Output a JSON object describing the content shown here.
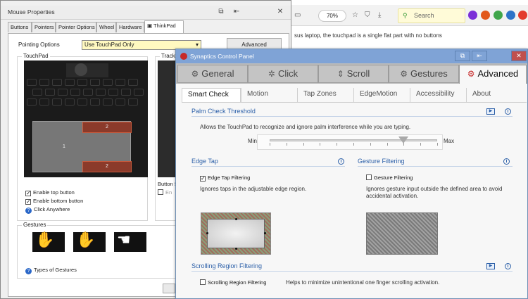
{
  "browser": {
    "zoom": "70%",
    "search_placeholder": "Search",
    "page_text": "sus laptop, the touchpad is a single flat part with no buttons"
  },
  "mouse_properties": {
    "title": "Mouse Properties",
    "tabs": [
      "Buttons",
      "Pointers",
      "Pointer Options",
      "Wheel",
      "Hardware",
      "ThinkPad"
    ],
    "pointing_options_label": "Pointing Options",
    "pointing_options_value": "Use TouchPad Only",
    "advanced_button": "Advanced",
    "touchpad_group": "TouchPad",
    "trackpoint_group": "TrackPo",
    "zone_top": "2",
    "zone_main": "1",
    "zone_bottom": "2",
    "enable_top_button": "Enable top button",
    "enable_bottom_button": "Enable bottom button",
    "click_anywhere": "Click Anywhere",
    "button_s_label": "Button S",
    "en_label": "En",
    "gestures_group": "Gestures",
    "types_of_gestures": "Types of Gestures"
  },
  "synaptics": {
    "title": "Synaptics Control Panel",
    "main_tabs": [
      {
        "label": "General",
        "icon": "gear-icon"
      },
      {
        "label": "Click",
        "icon": "click-icon"
      },
      {
        "label": "Scroll",
        "icon": "scroll-icon"
      },
      {
        "label": "Gestures",
        "icon": "gear-icon"
      },
      {
        "label": "Advanced",
        "icon": "gear-icon"
      }
    ],
    "active_main_tab": "Advanced",
    "sub_tabs": [
      "Smart Check",
      "Motion",
      "Tap Zones",
      "EdgeMotion",
      "Accessibility",
      "About"
    ],
    "active_sub_tab": "Smart Check",
    "palm_check": {
      "heading": "Palm Check Threshold",
      "description": "Allows the TouchPad to recognize and ignore palm interference while you are typing.",
      "min_label": "Min",
      "max_label": "Max",
      "value_fraction": 0.8
    },
    "edge_tap": {
      "heading": "Edge Tap",
      "checkbox_label": "Edge Tap Filtering",
      "checked": true,
      "description": "Ignores taps in the adjustable edge region."
    },
    "gesture_filtering": {
      "heading": "Gesture Filtering",
      "checkbox_label": "Gesture Filtering",
      "checked": false,
      "description": "Ignores gesture input outside the defined area to avoid accidental activation."
    },
    "scrolling_region": {
      "heading": "Scrolling Region Filtering",
      "checkbox_label": "Scrolling Region Filtering",
      "checked": false,
      "description": "Helps to minimize unintentional one finger scrolling activation."
    }
  },
  "colors": {
    "accent_red": "#c62828",
    "heading_blue": "#2b5fa8",
    "title_bar_blue": "#7fa3d6"
  }
}
